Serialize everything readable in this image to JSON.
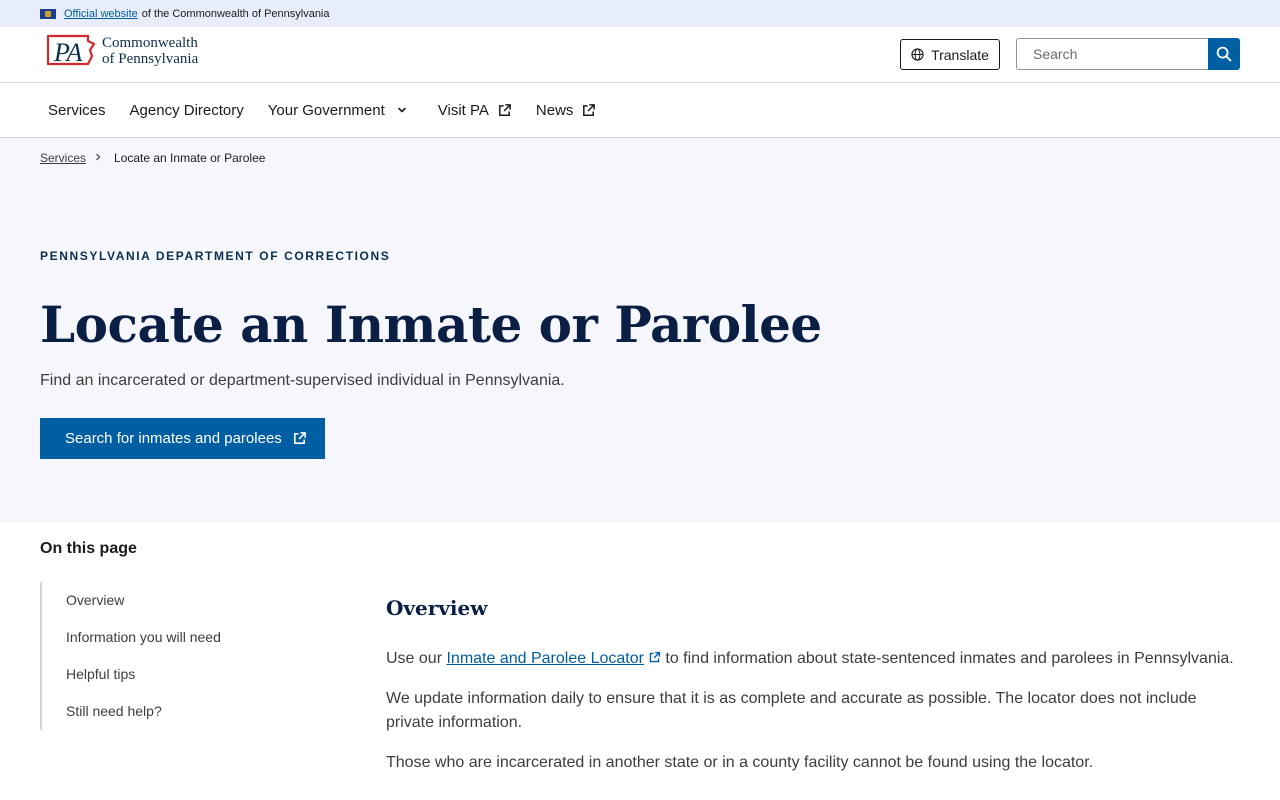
{
  "official_bar": {
    "link_text": "Official website",
    "rest_text": "of the Commonwealth of Pennsylvania"
  },
  "header": {
    "logo_mark": "PA",
    "logo_line1": "Commonwealth",
    "logo_line2": "of Pennsylvania",
    "translate_label": "Translate",
    "search_placeholder": "Search"
  },
  "nav": {
    "items": [
      {
        "label": "Services"
      },
      {
        "label": "Agency Directory"
      },
      {
        "label": "Your Government"
      },
      {
        "label": "Visit PA"
      },
      {
        "label": "News"
      }
    ]
  },
  "breadcrumb": {
    "parent": "Services",
    "current": "Locate an Inmate or Parolee"
  },
  "hero": {
    "department": "PENNSYLVANIA DEPARTMENT OF CORRECTIONS",
    "title": "Locate an Inmate or Parolee",
    "subtitle": "Find an incarcerated or department-supervised individual in Pennsylvania.",
    "cta_label": "Search for inmates and parolees"
  },
  "on_this_page": {
    "heading": "On this page",
    "items": [
      {
        "label": "Overview"
      },
      {
        "label": "Information you will need"
      },
      {
        "label": "Helpful tips"
      },
      {
        "label": "Still need help?"
      }
    ]
  },
  "content": {
    "section_title": "Overview",
    "para1_prefix": "Use our ",
    "para1_link": "Inmate and Parolee Locator",
    "para1_suffix": " to find information about state-sentenced inmates and parolees in Pennsylvania.",
    "para2": "We update information daily to ensure that it is as complete and accurate as possible. The locator does not include private information.",
    "para3": "Those who are incarcerated in another state or in a county facility cannot be found using the locator."
  },
  "colors": {
    "primary": "#005ea2",
    "navy": "#0b1f44",
    "hero_bg": "#f6f7fc",
    "official_bar_bg": "#e8edfb",
    "logo_red": "#d02a2f"
  }
}
